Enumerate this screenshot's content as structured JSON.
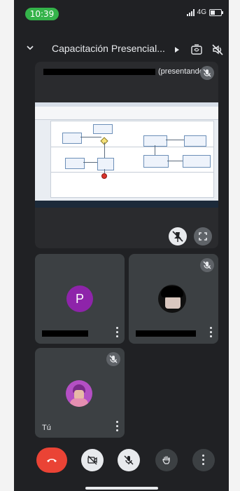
{
  "status_bar": {
    "time": "10:39",
    "network": "4G"
  },
  "header": {
    "meeting_title": "Capacitación Presencial..."
  },
  "presenter_tile": {
    "status": "(presentando)"
  },
  "participants": [
    {
      "initial": "P"
    },
    {},
    {
      "name": "Tú"
    }
  ],
  "colors": {
    "background": "#202124",
    "tile": "#3c4043",
    "hangup": "#ea4335",
    "avatar_p": "#8e24aa",
    "status_pill": "#34b34a"
  },
  "icons": {
    "back": "chevron-down-icon",
    "play": "play-icon",
    "switch_camera": "switch-camera-icon",
    "speaker_off": "speaker-off-icon",
    "mic_off": "mic-off-icon",
    "pin_off": "pin-off-icon",
    "fullscreen": "fullscreen-icon",
    "more": "more-vert-icon",
    "end_call": "end-call-icon",
    "camera_off": "camera-off-icon",
    "raise_hand": "hand-icon"
  }
}
